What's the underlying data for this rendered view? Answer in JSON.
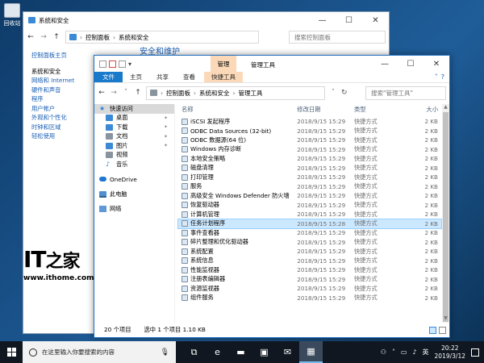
{
  "desktop": {
    "icon_label": "回收站"
  },
  "back_window": {
    "title": "系统和安全",
    "controls": {
      "minimize": "—",
      "maximize": "☐",
      "close": "✕"
    },
    "breadcrumbs": [
      "控制面板",
      "系统和安全"
    ],
    "search_placeholder": "搜索控制面板",
    "peek_text": "安全和维护",
    "sidebar": {
      "home": "控制面板主页",
      "items": [
        "系统和安全",
        "网络和 Internet",
        "硬件和声音",
        "程序",
        "用户帐户",
        "外观和个性化",
        "时钟和区域",
        "轻松使用"
      ]
    }
  },
  "watermark": {
    "logo": "IT之家",
    "url": "www.ithome.com"
  },
  "window": {
    "title": "管理工具",
    "context_tab_label": "管理",
    "controls": {
      "minimize": "—",
      "maximize": "☐",
      "close": "✕"
    },
    "ribbon_tabs": [
      "文件",
      "主页",
      "共享",
      "查看",
      "快捷工具"
    ],
    "breadcrumbs": [
      "控制面板",
      "系统和安全",
      "管理工具"
    ],
    "search_placeholder": "搜索\"管理工具\"",
    "nav": [
      {
        "label": "快速访问",
        "icon": "star-icon",
        "kind": "head",
        "selected": true
      },
      {
        "label": "桌面",
        "icon": "desktop-folder-icon",
        "kind": "sub",
        "pinned": true
      },
      {
        "label": "下载",
        "icon": "download-icon",
        "kind": "sub",
        "pinned": true
      },
      {
        "label": "文档",
        "icon": "document-icon",
        "kind": "sub",
        "pinned": true
      },
      {
        "label": "图片",
        "icon": "pictures-icon",
        "kind": "sub",
        "pinned": true
      },
      {
        "label": "视频",
        "icon": "video-icon",
        "kind": "sub",
        "pinned": false
      },
      {
        "label": "音乐",
        "icon": "music-icon",
        "kind": "sub",
        "pinned": false
      },
      {
        "label": "OneDrive",
        "icon": "onedrive-icon",
        "kind": "head",
        "gap": true
      },
      {
        "label": "此电脑",
        "icon": "this-pc-icon",
        "kind": "head",
        "gap": true
      },
      {
        "label": "网络",
        "icon": "network-icon",
        "kind": "head",
        "gap": true
      }
    ],
    "columns": {
      "name": "名称",
      "date": "修改日期",
      "type": "类型",
      "size": "大小"
    },
    "files": [
      {
        "name": "iSCSI 发起程序",
        "date": "2018/9/15 15:29",
        "type": "快捷方式",
        "size": "2 KB"
      },
      {
        "name": "ODBC Data Sources (32-bit)",
        "date": "2018/9/15 15:29",
        "type": "快捷方式",
        "size": "2 KB"
      },
      {
        "name": "ODBC 数据源(64 位)",
        "date": "2018/9/15 15:29",
        "type": "快捷方式",
        "size": "2 KB"
      },
      {
        "name": "Windows 内存诊断",
        "date": "2018/9/15 15:29",
        "type": "快捷方式",
        "size": "2 KB"
      },
      {
        "name": "本地安全策略",
        "date": "2018/9/15 15:29",
        "type": "快捷方式",
        "size": "2 KB"
      },
      {
        "name": "磁盘清理",
        "date": "2018/9/15 15:29",
        "type": "快捷方式",
        "size": "2 KB"
      },
      {
        "name": "打印管理",
        "date": "2018/9/15 15:29",
        "type": "快捷方式",
        "size": "2 KB"
      },
      {
        "name": "服务",
        "date": "2018/9/15 15:29",
        "type": "快捷方式",
        "size": "2 KB"
      },
      {
        "name": "高级安全 Windows Defender 防火墙",
        "date": "2018/9/15 15:29",
        "type": "快捷方式",
        "size": "2 KB"
      },
      {
        "name": "恢复驱动器",
        "date": "2018/9/15 15:29",
        "type": "快捷方式",
        "size": "2 KB"
      },
      {
        "name": "计算机管理",
        "date": "2018/9/15 15:29",
        "type": "快捷方式",
        "size": "2 KB"
      },
      {
        "name": "任务计划程序",
        "date": "2018/9/15 15:28",
        "type": "快捷方式",
        "size": "2 KB",
        "selected": true
      },
      {
        "name": "事件查看器",
        "date": "2018/9/15 15:29",
        "type": "快捷方式",
        "size": "2 KB"
      },
      {
        "name": "碎片整理和优化驱动器",
        "date": "2018/9/15 15:29",
        "type": "快捷方式",
        "size": "2 KB"
      },
      {
        "name": "系统配置",
        "date": "2018/9/15 15:29",
        "type": "快捷方式",
        "size": "2 KB"
      },
      {
        "name": "系统信息",
        "date": "2018/9/15 15:29",
        "type": "快捷方式",
        "size": "2 KB"
      },
      {
        "name": "性能监视器",
        "date": "2018/9/15 15:29",
        "type": "快捷方式",
        "size": "2 KB"
      },
      {
        "name": "注册表编辑器",
        "date": "2018/9/15 15:29",
        "type": "快捷方式",
        "size": "2 KB"
      },
      {
        "name": "资源监视器",
        "date": "2018/9/15 15:29",
        "type": "快捷方式",
        "size": "2 KB"
      },
      {
        "name": "组件服务",
        "date": "2018/9/15 15:29",
        "type": "快捷方式",
        "size": "2 KB"
      }
    ],
    "status": {
      "count": "20 个项目",
      "selection": "选中 1 个项目  1.10 KB"
    }
  },
  "taskbar": {
    "search_placeholder": "在这里输入你要搜索的内容",
    "apps": [
      {
        "name": "task-view-icon",
        "glyph": "⧉",
        "active": false
      },
      {
        "name": "edge-icon",
        "glyph": "e",
        "active": false
      },
      {
        "name": "file-explorer-icon",
        "glyph": "▬",
        "active": false
      },
      {
        "name": "store-icon",
        "glyph": "▣",
        "active": false
      },
      {
        "name": "mail-icon",
        "glyph": "✉",
        "active": false
      },
      {
        "name": "control-panel-icon",
        "glyph": "▦",
        "active": true
      }
    ],
    "ime": "英",
    "time": "20:22",
    "date": "2019/3/12"
  },
  "colors": {
    "accent": "#1979ca",
    "selection": "#cce8ff",
    "context_tab": "#fbd9b8",
    "taskbar": "#101720"
  }
}
